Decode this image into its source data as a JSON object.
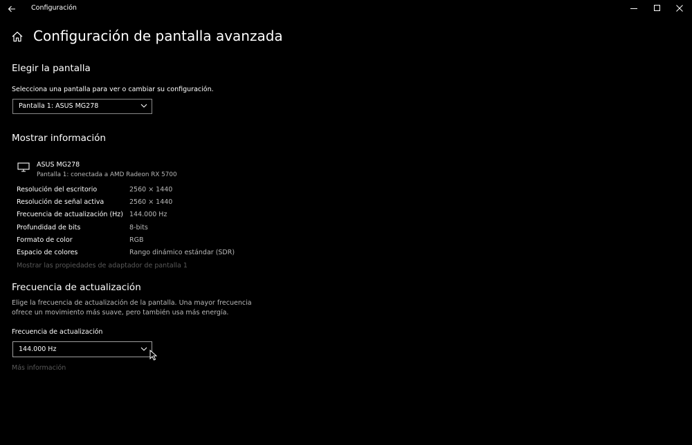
{
  "app": {
    "title": "Configuración"
  },
  "page": {
    "title": "Configuración de pantalla avanzada"
  },
  "choose_display": {
    "heading": "Elegir la pantalla",
    "instruction": "Selecciona una pantalla para ver o cambiar su configuración.",
    "selected": "Pantalla 1: ASUS MG278"
  },
  "display_info": {
    "heading": "Mostrar información",
    "monitor_name": "ASUS MG278",
    "monitor_sub": "Pantalla 1: conectada a AMD Radeon RX 5700",
    "rows": [
      {
        "label": "Resolución del escritorio",
        "value": "2560 × 1440"
      },
      {
        "label": "Resolución de señal activa",
        "value": "2560 × 1440"
      },
      {
        "label": "Frecuencia de actualización (Hz)",
        "value": "144.000 Hz"
      },
      {
        "label": "Profundidad de bits",
        "value": "8-bits"
      },
      {
        "label": "Formato de color",
        "value": "RGB"
      },
      {
        "label": "Espacio de colores",
        "value": "Rango dinámico estándar (SDR)"
      }
    ],
    "adapter_link": "Mostrar las propiedades de adaptador de pantalla 1"
  },
  "refresh": {
    "heading": "Frecuencia de actualización",
    "description_line1": "Elige la frecuencia de actualización de la pantalla. Una mayor frecuencia",
    "description_line2": "ofrece un movimiento más suave, pero también usa más energía.",
    "field_label": "Frecuencia de actualización",
    "selected": "144.000 Hz",
    "more_info": "Más información"
  },
  "icons": {
    "back": "back-arrow-icon",
    "minimize": "minimize-icon",
    "maximize": "maximize-icon",
    "close": "close-icon",
    "home": "home-icon",
    "monitor": "monitor-icon",
    "chevron": "chevron-down-icon",
    "cursor": "mouse-cursor-icon"
  },
  "colors": {
    "background": "#000000",
    "text": "#ffffff",
    "secondary_text": "#b9b9b9",
    "disabled_text": "#5a5a5a",
    "dropdown_border": "#8a8a8a"
  }
}
